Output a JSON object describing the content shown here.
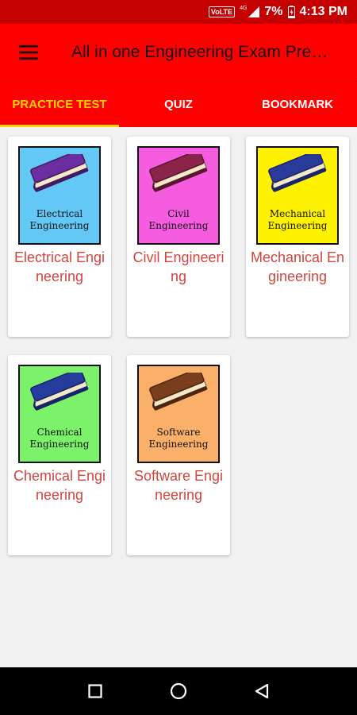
{
  "status_bar": {
    "volte": "VoLTE",
    "network": "4G",
    "battery": "7%",
    "time": "4:13 PM"
  },
  "toolbar": {
    "title": "All in one Engineering Exam Preparation",
    "menu_icon": "hamburger-menu-icon"
  },
  "tabs": [
    {
      "label": "PRACTICE TEST",
      "active": true
    },
    {
      "label": "QUIZ",
      "active": false
    },
    {
      "label": "BOOKMARK",
      "active": false
    }
  ],
  "cards": [
    {
      "cover_line1": "Electrical",
      "cover_line2": "Engineering",
      "label": "Electrical Engineering",
      "bg": "#63c8f5",
      "book": "#6a2ea0",
      "book_dark": "#43195f"
    },
    {
      "cover_line1": "Civil",
      "cover_line2": "Engineering",
      "label": "Civil Engineering",
      "bg": "#f55ce0",
      "book": "#8a2448",
      "book_dark": "#5a1630"
    },
    {
      "cover_line1": "Mechanical",
      "cover_line2": "Engineering",
      "label": "Mechanical Engineering",
      "bg": "#fff200",
      "book": "#2a3a9a",
      "book_dark": "#1a2468"
    },
    {
      "cover_line1": "Chemical",
      "cover_line2": "Engineering",
      "label": "Chemical Engineering",
      "bg": "#7cf26a",
      "book": "#253c9c",
      "book_dark": "#16246a"
    },
    {
      "cover_line1": "Software",
      "cover_line2": "Engineering",
      "label": "Software Engineering",
      "bg": "#fbb06a",
      "book": "#7a3e1e",
      "book_dark": "#4e2610"
    }
  ],
  "colors": {
    "status_bar": "#c40000",
    "app_bar": "#ff0000",
    "active_tab": "#ffd400",
    "card_label": "#d0453f"
  }
}
